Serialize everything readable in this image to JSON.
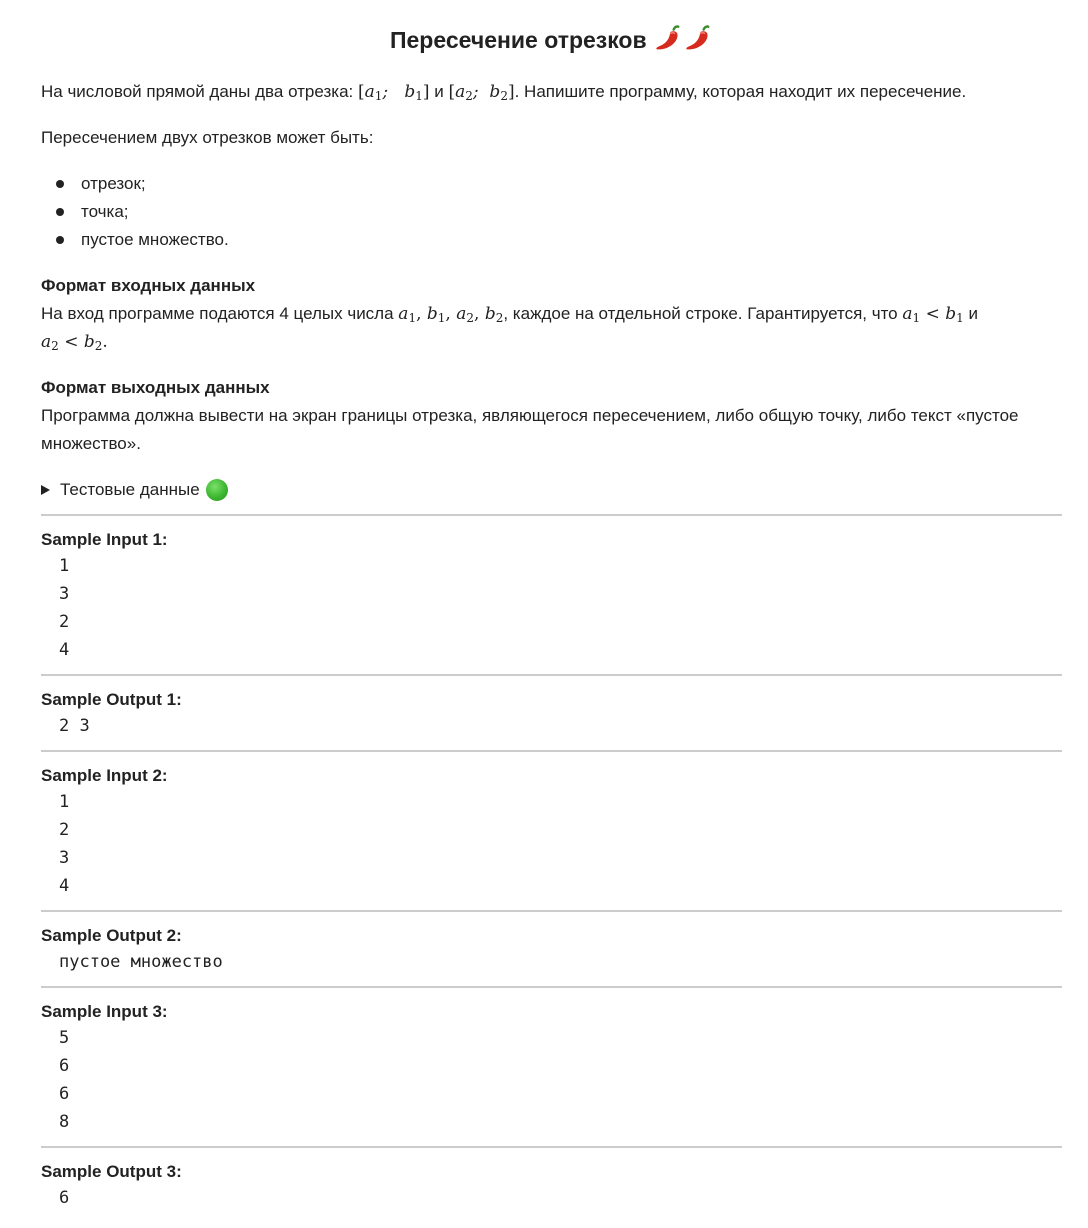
{
  "title": "Пересечение отрезков",
  "intro": {
    "before": "На числовой прямой даны два отрезка: ",
    "and": " и ",
    "after": ". Напишите программу, которая находит их пересечение."
  },
  "intersection_intro": "Пересечением двух отрезков может быть:",
  "bullets": [
    "отрезок;",
    "точка;",
    "пустое множество."
  ],
  "input_format": {
    "heading": "Формат входных данных",
    "text_before": "На вход программе подаются 4 целых числа ",
    "text_middle": ", каждое на отдельной строке. Гарантируется, что ",
    "text_and": " и"
  },
  "output_format": {
    "heading": "Формат выходных данных",
    "text": "Программа должна вывести на экран границы отрезка, являющегося пересечением, либо общую точку, либо текст «пустое множество»."
  },
  "test_data_label": "Тестовые данные",
  "samples": [
    {
      "label": "Sample Input 1:",
      "lines": [
        "1",
        "3",
        "2",
        "4"
      ]
    },
    {
      "label": "Sample Output 1:",
      "lines": [
        "2 3"
      ]
    },
    {
      "label": "Sample Input 2:",
      "lines": [
        "1",
        "2",
        "3",
        "4"
      ]
    },
    {
      "label": "Sample Output 2:",
      "lines": [
        "пустое множество"
      ]
    },
    {
      "label": "Sample Input 3:",
      "lines": [
        "5",
        "6",
        "6",
        "8"
      ]
    },
    {
      "label": "Sample Output 3:",
      "lines": [
        "6"
      ]
    }
  ],
  "icons": {
    "title_icon": "chili-pepper-icon",
    "test_data_icon": "green-circle-icon"
  },
  "colors": {
    "text": "#222222",
    "divider": "#cccccc",
    "green": "#3cb731",
    "chili": "#d62a1e"
  }
}
